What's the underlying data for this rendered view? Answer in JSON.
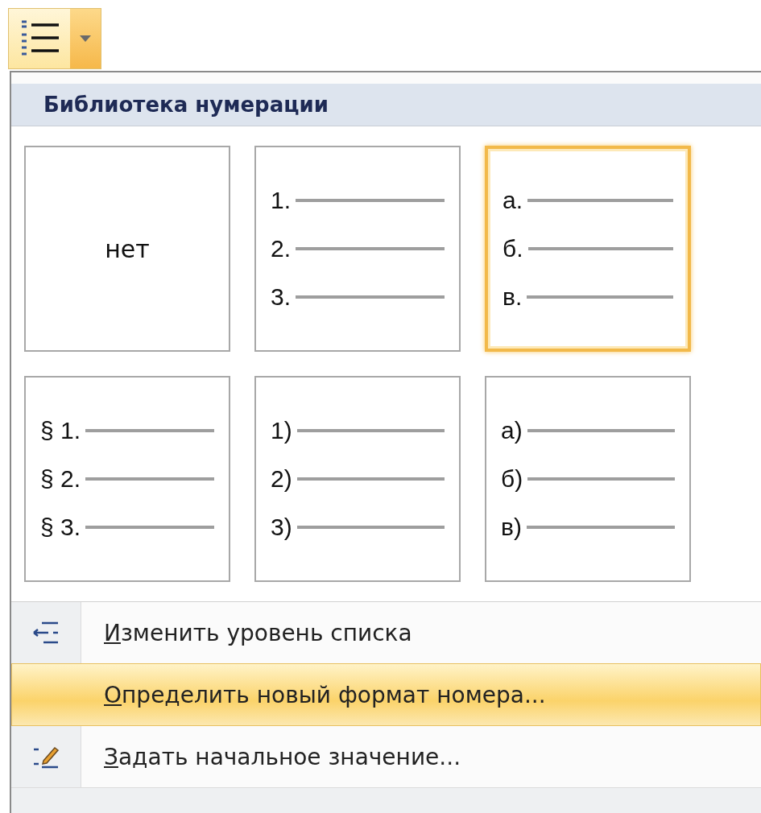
{
  "toolbar": {
    "button": {
      "selected": true
    }
  },
  "menu": {
    "header": "Библиотека нумерации",
    "tiles": [
      {
        "kind": "none",
        "text": "нет",
        "selected": false
      },
      {
        "kind": "list",
        "markers": [
          "1.",
          "2.",
          "3."
        ],
        "selected": false
      },
      {
        "kind": "list",
        "markers": [
          "а.",
          "б.",
          "в."
        ],
        "selected": true
      },
      {
        "kind": "list",
        "markers": [
          "§ 1.",
          "§ 2.",
          "§ 3."
        ],
        "selected": false
      },
      {
        "kind": "list",
        "markers": [
          "1)",
          "2)",
          "3)"
        ],
        "selected": false
      },
      {
        "kind": "list",
        "markers": [
          "а)",
          "б)",
          "в)"
        ],
        "selected": false
      }
    ],
    "items": [
      {
        "kind": "indent",
        "label": "Изменить уровень списка",
        "selected": false
      },
      {
        "kind": "blank",
        "label": "Определить новый формат номера...",
        "selected": true
      },
      {
        "kind": "start",
        "label": "Задать начальное значение...",
        "selected": false
      }
    ]
  }
}
